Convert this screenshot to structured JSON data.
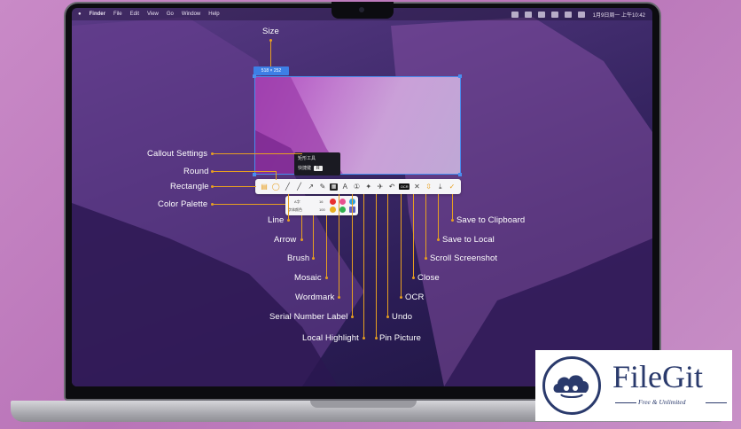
{
  "menubar": {
    "apple": "",
    "items": [
      "Finder",
      "File",
      "Edit",
      "View",
      "Go",
      "Window",
      "Help"
    ],
    "clock": "1月9日周一 上午10:42"
  },
  "selection": {
    "size_badge": "518 × 252",
    "tooltip_title": "矩形工具",
    "tooltip_key_label": "快捷键",
    "tooltip_key": "R"
  },
  "palette": {
    "label_a": "A字",
    "label_b": "字体颜色",
    "value_a": "16",
    "value_b": "100",
    "colors": [
      "#e83030",
      "#e85090",
      "#30a0e0",
      "#e8b020",
      "#30b050",
      "#6060c0"
    ]
  },
  "annotations": {
    "size": "Size",
    "callout_settings": "Callout Settings",
    "round": "Round",
    "rectangle": "Rectangle",
    "color_palette": "Color Palette",
    "line": "Line",
    "arrow": "Arrow",
    "brush": "Brush",
    "mosaic": "Mosaic",
    "wordmark": "Wordmark",
    "serial_number_label": "Serial Number Label",
    "local_highlight": "Local Highlight",
    "pin_picture": "Pin Picture",
    "undo": "Undo",
    "ocr": "OCR",
    "close": "Close",
    "scroll_screenshot": "Scroll Screenshot",
    "save_to_local": "Save to Local",
    "save_to_clipboard": "Save to Clipboard"
  },
  "toolbar": {
    "icons": [
      "document-icon",
      "round-icon",
      "rectangle-icon",
      "line-icon",
      "arrow-icon",
      "brush-icon",
      "mosaic-icon",
      "wordmark-icon",
      "serial-number-icon",
      "highlight-icon",
      "pin-icon",
      "undo-icon",
      "ocr-icon",
      "close-icon",
      "scroll-icon",
      "save-local-icon",
      "save-clipboard-icon"
    ],
    "ocr_label": "OCR"
  },
  "brand": {
    "name": "FileGit",
    "tagline": "Free & Unlimited",
    "color": "#2a3a6c"
  }
}
